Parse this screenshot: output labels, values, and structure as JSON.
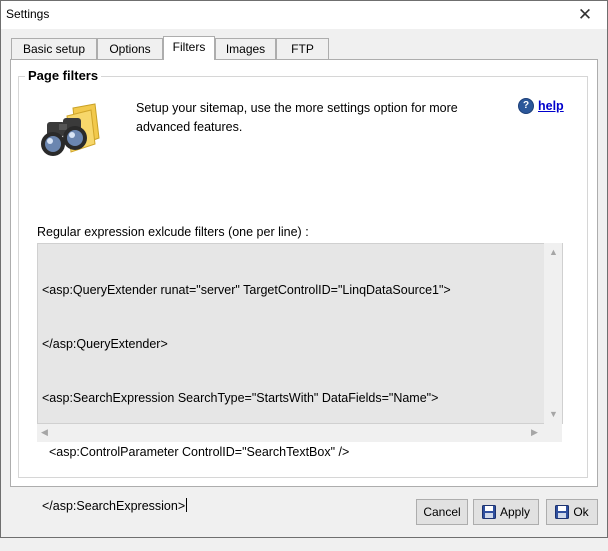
{
  "window": {
    "title": "Settings"
  },
  "tabs": [
    {
      "label": "Basic setup"
    },
    {
      "label": "Options"
    },
    {
      "label": "Filters",
      "active": true
    },
    {
      "label": "Images"
    },
    {
      "label": "FTP"
    }
  ],
  "filters": {
    "group_title": "Page filters",
    "intro_text": "Setup your sitemap, use the more settings option for more advanced features.",
    "help_label": "help",
    "label": "Regular expression exlcude filters (one per line) :",
    "lines": [
      "<asp:QueryExtender runat=\"server\" TargetControlID=\"LinqDataSource1\">",
      "</asp:QueryExtender>",
      "<asp:SearchExpression SearchType=\"StartsWith\" DataFields=\"Name\">",
      "  <asp:ControlParameter ControlID=\"SearchTextBox\" />",
      "</asp:SearchExpression>"
    ]
  },
  "buttons": {
    "cancel": "Cancel",
    "apply": "Apply",
    "ok": "Ok"
  },
  "colors": {
    "editor_bg": "#e6e6e6",
    "link": "#0000cc",
    "help_icon": "#2b579a"
  },
  "icons": {
    "close": "close-icon",
    "header": "binoculars-icon",
    "help": "help-icon",
    "save": "floppy-disk-icon"
  }
}
